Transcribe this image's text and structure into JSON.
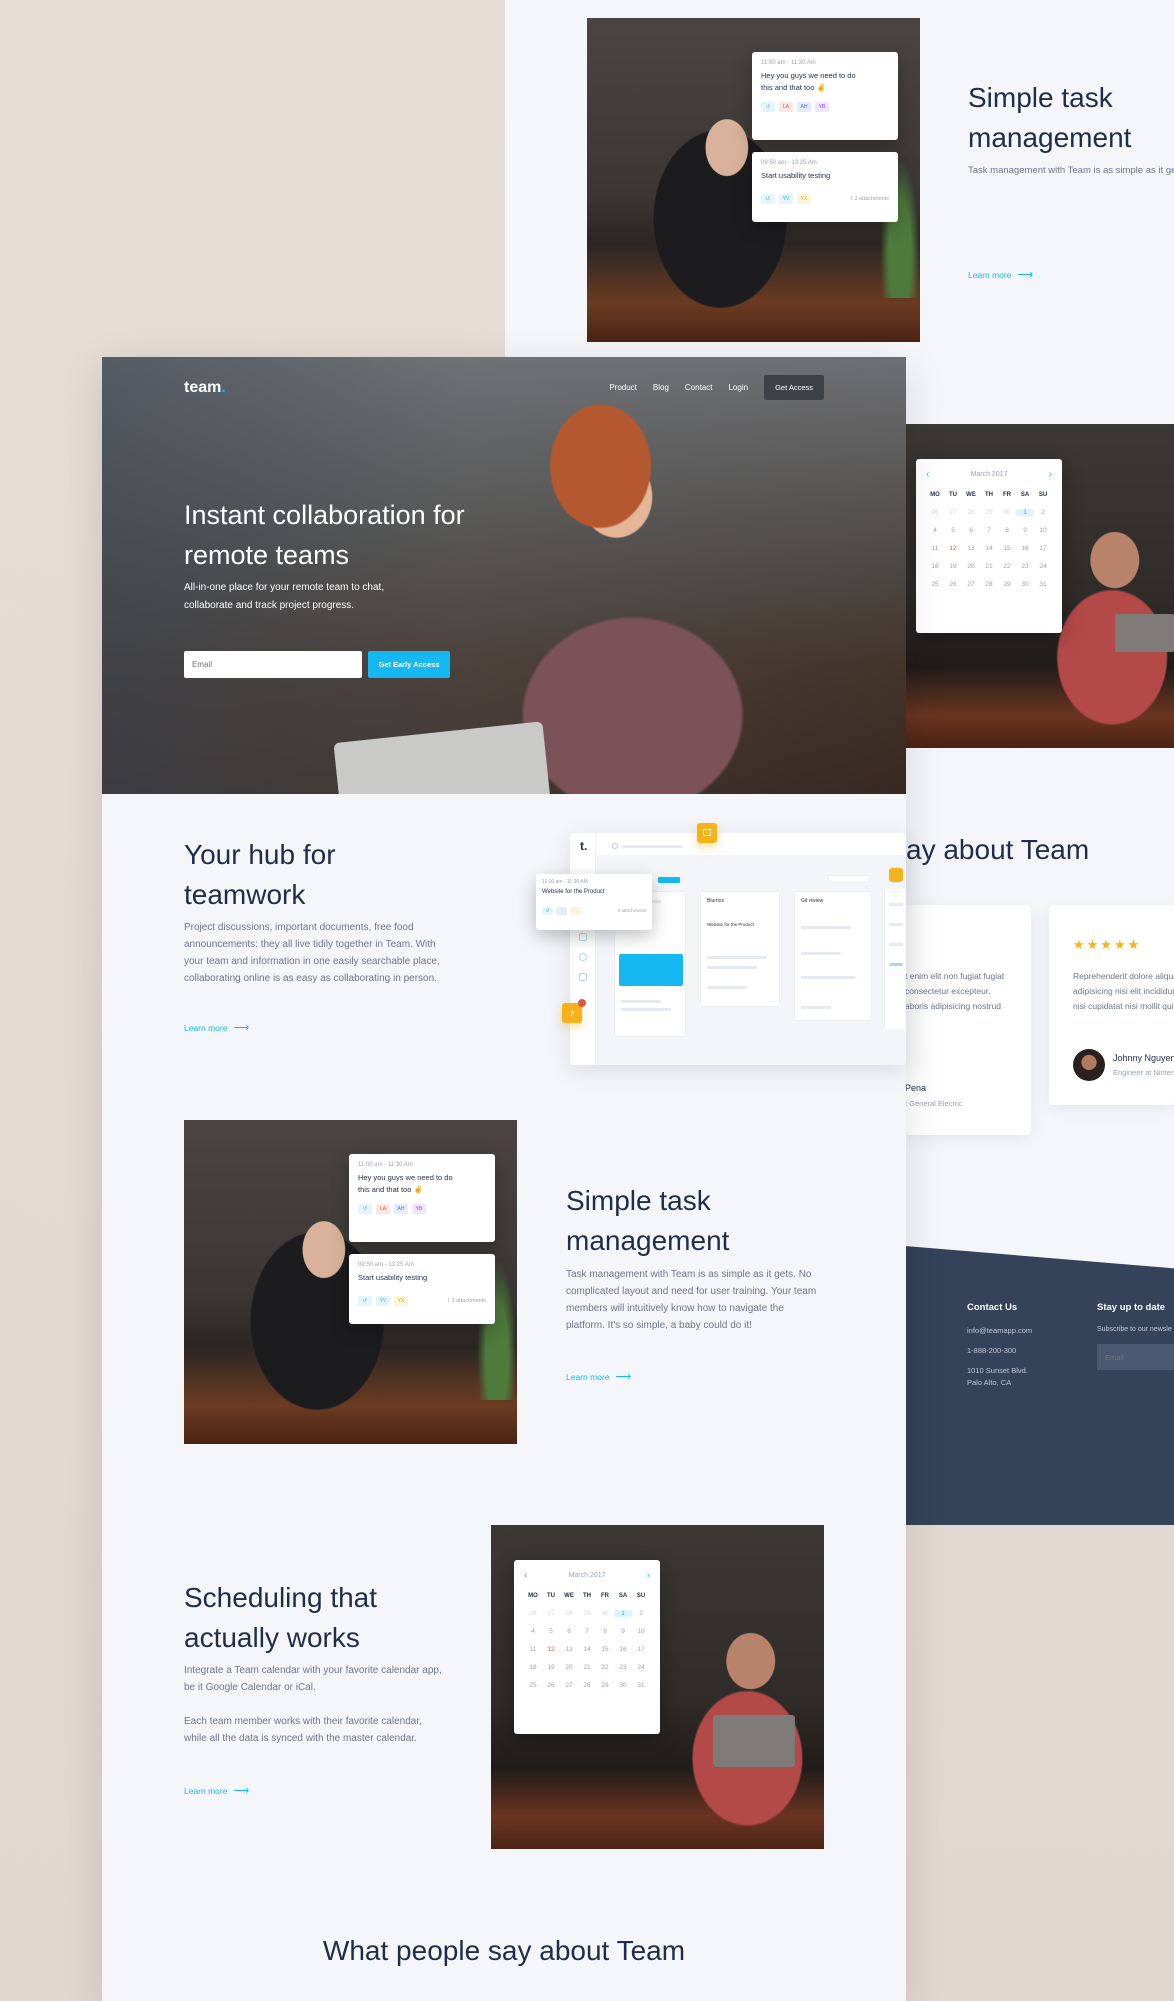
{
  "back": {
    "task": {
      "title": "Simple task management",
      "body": "Task management with Team is as simple as it gets. No complicated layout and need for user training. Your team members will intuitively know how to navigate the platform. It's so simple, a baby could do it!",
      "learn_more": "Learn more"
    },
    "card1": {
      "time": "11:00 am - 11:30 Am",
      "msg": "Hey you guys we need to do this and that too ✌️",
      "chips": [
        "LA",
        "AH",
        "YB"
      ]
    },
    "card2": {
      "time": "09:50 am - 13:25 Am",
      "msg": "Start usability testing",
      "chips": [
        "YV",
        "YX"
      ],
      "attachments": "3 attachments"
    },
    "calendar": {
      "month": "March 2017"
    },
    "testimonials_title": "ay about Team",
    "testimonial_left": {
      "text": "t enim elit non fugiat fugiat consectetur excepteur. aboris adipisicing nostrud",
      "name": "Pena",
      "role": "t General Electric"
    },
    "testimonial_right": {
      "stars": "★★★★★",
      "text": "Reprehenderit dolore aliqua adipisicing nisi elit incididunt nisi cupidatat nisi mollit qui",
      "name": "Johnny Nguyen",
      "role": "Engineer at Nintendo"
    },
    "footer": {
      "contact_title": "Contact Us",
      "email": "info@teamapp.com",
      "phone": "1-888-200-300",
      "address1": "1010 Sunset Blvd.",
      "address2": "Palo Alto, CA",
      "subscribe_title": "Stay up to date",
      "subscribe_text": "Subscribe to our newsle",
      "email_placeholder": "Email"
    }
  },
  "front": {
    "nav": {
      "logo": "team",
      "logo_dot": ".",
      "links": [
        "Product",
        "Blog",
        "Contact",
        "Login"
      ],
      "cta": "Get Access"
    },
    "hero": {
      "title": "Instant collaboration for remote teams",
      "subtitle": "All-in-one place for your remote team to chat, collaborate and track project progress.",
      "email_placeholder": "Email",
      "button": "Get Early Access"
    },
    "hub": {
      "title": "Your hub for teamwork",
      "body": "Project discussions, important documents, free food announcements: they all live tidily together in Team. With your team and information in one easily searchable place, collaborating online is as easy as collaborating in person.",
      "learn_more": "Learn more"
    },
    "app": {
      "logo": "t.",
      "popup_time": "11:00 am - 11:30 AM",
      "popup_title": "Website for the Product",
      "popup_attach": "3 attachments",
      "columns": [
        "Blurrios",
        "Git review"
      ],
      "column_item": "Website for the Product"
    },
    "task": {
      "title": "Simple task management",
      "body": "Task management with Team is as simple as it gets. No complicated layout and need for user training. Your team members will intuitively know how to navigate the platform. It's so simple, a baby could do it!",
      "learn_more": "Learn more"
    },
    "card1": {
      "time": "11:00 am - 11:30 Am",
      "msg": "Hey you guys we need to do this and that too ✌️",
      "chips": [
        "LA",
        "AH",
        "YB"
      ]
    },
    "card2": {
      "time": "09:50 am - 13:25 Am",
      "msg": "Start usability testing",
      "chips": [
        "YV",
        "YX"
      ],
      "attachments": "3 attachments"
    },
    "schedule": {
      "title": "Scheduling that actually works",
      "body1": "Integrate a Team calendar with your favorite calendar app, be it Google Calendar or iCal.",
      "body2": "Each team member works with their favorite calendar, while all the data is synced with the master calendar.",
      "learn_more": "Learn more"
    },
    "calendar": {
      "month": "March 2017"
    },
    "testimonials_title": "What people say about Team"
  },
  "calendar_days": {
    "dow": [
      "MO",
      "TU",
      "WE",
      "TH",
      "FR",
      "SA",
      "SU"
    ],
    "days": [
      "26",
      "27",
      "28",
      "29",
      "30",
      "1",
      "2",
      "4",
      "5",
      "6",
      "7",
      "8",
      "9",
      "10",
      "11",
      "12",
      "13",
      "14",
      "15",
      "16",
      "17",
      "18",
      "19",
      "20",
      "21",
      "22",
      "23",
      "24",
      "25",
      "26",
      "27",
      "28",
      "29",
      "30",
      "31"
    ]
  },
  "colors": {
    "accent": "#15b8f0",
    "navy": "#1f2d4a",
    "footer_bg": "#34425a",
    "star": "#f5b21b",
    "notif": "#f5b21b"
  }
}
